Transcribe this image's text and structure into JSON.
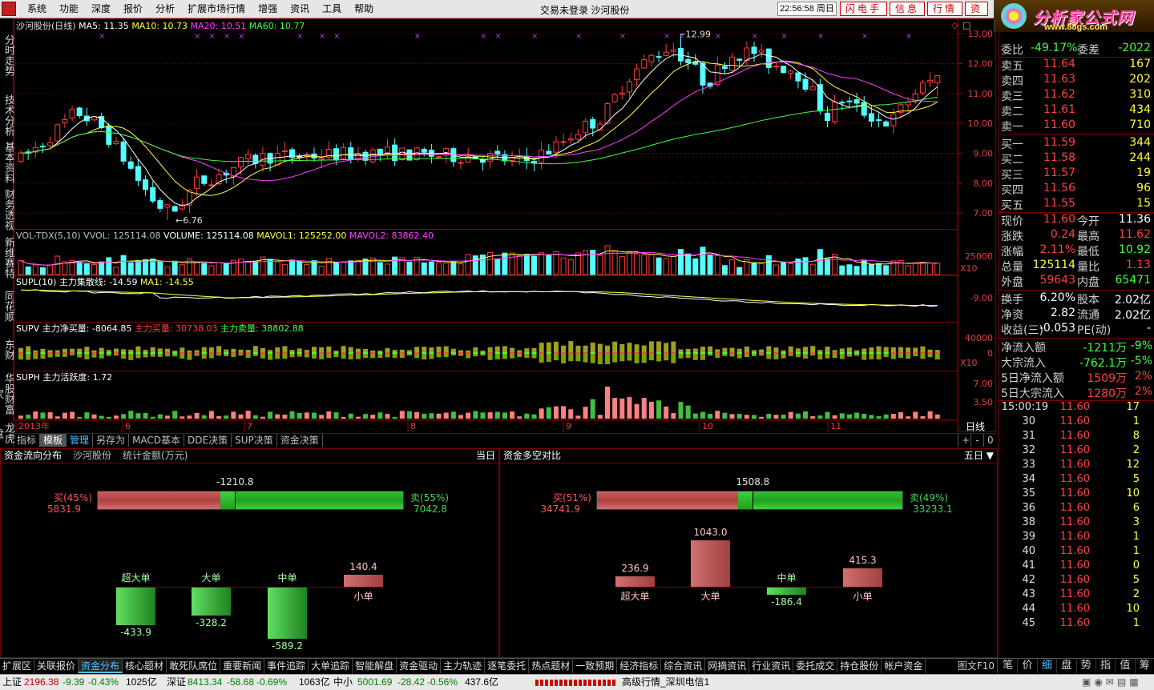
{
  "menubar": {
    "items": [
      "系统",
      "功能",
      "深度",
      "报价",
      "分析",
      "扩展市场行情",
      "增强",
      "资讯",
      "工具",
      "帮助"
    ],
    "center_text": "交易未登录  沙河股份",
    "clock": "22:56:58 周日",
    "buttons": [
      "闪电手",
      "信息",
      "行情",
      "资"
    ],
    "ad_title": "分析家公式网",
    "ad_url": "www.88gs.com"
  },
  "left_tabs": [
    "分时走势",
    "技术分析",
    "基本资料",
    "财务透视",
    "新维赛特",
    "同花顺",
    "东财",
    "华股财富家",
    "龙虎盘"
  ],
  "chart": {
    "title_stock": "沙河股份(日线)",
    "ma_labels": [
      {
        "text": "MA5: 11.35",
        "color": "#ffffff"
      },
      {
        "text": "MA10: 10.73",
        "color": "#ffff40"
      },
      {
        "text": "MA20: 10.51",
        "color": "#ff40ff"
      },
      {
        "text": "MA60: 10.77",
        "color": "#40ff40"
      }
    ],
    "price_axis": [
      "13.00",
      "12.00",
      "11.00",
      "10.00",
      "9.00",
      "8.00",
      "7.00"
    ],
    "high_label": "12.99",
    "low_label": "6.76",
    "vol_title": [
      {
        "text": "VOL-TDX(5,10)  VVOL: 125114.08",
        "color": "#c0c0c0"
      },
      {
        "text": "VOLUME: 125114.08",
        "color": "#ffffff"
      },
      {
        "text": "MAVOL1: 125252.00",
        "color": "#ffff40"
      },
      {
        "text": "MAVOL2: 83862.40",
        "color": "#ff40ff"
      }
    ],
    "vol_axis": "25000",
    "vol_mult": "X10",
    "supl_title": [
      {
        "text": "SUPL(10)  主力集散线: -14.59",
        "color": "#ffffff"
      },
      {
        "text": "MA1: -14.55",
        "color": "#ffff40"
      }
    ],
    "supl_axis": "-9.00",
    "supv_title": [
      {
        "text": "SUPV  主力净买量: -8064.85",
        "color": "#ffffff"
      },
      {
        "text": "主力买量: 30738.03",
        "color": "#ff4040"
      },
      {
        "text": "主力卖量: 38802.88",
        "color": "#40ff40"
      }
    ],
    "supv_axis": [
      "40000",
      "0"
    ],
    "supv_mult": "X10",
    "suph_title": "SUPH  主力活跃度: 1.72",
    "suph_axis": [
      "7.00",
      "3.50"
    ],
    "date_labels": [
      "2013年",
      "6",
      "7",
      "8",
      "9",
      "10",
      "11"
    ],
    "period": "日线"
  },
  "bottom_tabs": [
    "指标",
    "模板",
    "管理",
    "另存为",
    "MACD基本",
    "DDE决策",
    "SUP决策",
    "资金决策"
  ],
  "panel_left": {
    "title": "资金流向分布",
    "stock": "沙河股份",
    "unit": "统计金额(万元)",
    "range": "当日",
    "net": "-1210.8",
    "buy_label": "买(45%)",
    "buy_value": "5831.9",
    "sell_label": "卖(55%)",
    "sell_value": "7042.8",
    "buy_ratio": 0.45,
    "bars": [
      {
        "name": "超大单",
        "value": -433.9,
        "text": "-433.9"
      },
      {
        "name": "大单",
        "value": -328.2,
        "text": "-328.2"
      },
      {
        "name": "中单",
        "value": -589.2,
        "text": "-589.2"
      },
      {
        "name": "小单",
        "value": 140.4,
        "text": "140.4"
      }
    ]
  },
  "panel_right": {
    "title": "资金多空对比",
    "range": "五日",
    "net": "1508.8",
    "buy_label": "买(51%)",
    "buy_value": "34741.9",
    "sell_label": "卖(49%)",
    "sell_value": "33233.1",
    "buy_ratio": 0.51,
    "bars": [
      {
        "name": "超大单",
        "value": 236.9,
        "text": "236.9"
      },
      {
        "name": "大单",
        "value": 1043.0,
        "text": "1043.0"
      },
      {
        "name": "中单",
        "value": -186.4,
        "text": "-186.4"
      },
      {
        "name": "小单",
        "value": 415.3,
        "text": "415.3"
      }
    ]
  },
  "funcbar": [
    "扩展区",
    "关联报价",
    "资金分布",
    "核心题材",
    "敢死队席位",
    "重要新闻",
    "事件追踪",
    "大单追踪",
    "智能解盘",
    "资金驱动",
    "主力轨迹",
    "逐笔委托",
    "热点题材",
    "一致预期",
    "经济指标",
    "综合资讯",
    "网摘资讯",
    "行业资讯",
    "委托成交",
    "持仓股份",
    "帐户资金"
  ],
  "funcbar_active": "资金分布",
  "funcbar_pic": "图文F10",
  "quote": {
    "ratio": {
      "label1": "委比",
      "value1": "-49.17%",
      "label2": "委差",
      "value2": "-2022"
    },
    "sells": [
      {
        "name": "卖五",
        "price": "11.64",
        "vol": "167"
      },
      {
        "name": "卖四",
        "price": "11.63",
        "vol": "202"
      },
      {
        "name": "卖三",
        "price": "11.62",
        "vol": "310"
      },
      {
        "name": "卖二",
        "price": "11.61",
        "vol": "434"
      },
      {
        "name": "卖一",
        "price": "11.60",
        "vol": "710"
      }
    ],
    "buys": [
      {
        "name": "买一",
        "price": "11.59",
        "vol": "344"
      },
      {
        "name": "买二",
        "price": "11.58",
        "vol": "244"
      },
      {
        "name": "买三",
        "price": "11.57",
        "vol": "19"
      },
      {
        "name": "买四",
        "price": "11.56",
        "vol": "96"
      },
      {
        "name": "买五",
        "price": "11.55",
        "vol": "15"
      }
    ],
    "stats": [
      {
        "k1": "现价",
        "v1": "11.60",
        "c1": "#ff4040",
        "k2": "今开",
        "v2": "11.36",
        "c2": "#ffffff"
      },
      {
        "k1": "涨跌",
        "v1": "0.24",
        "c1": "#ff4040",
        "k2": "最高",
        "v2": "11.62",
        "c2": "#ff4040"
      },
      {
        "k1": "涨幅",
        "v1": "2.11%",
        "c1": "#ff4040",
        "k2": "最低",
        "v2": "10.92",
        "c2": "#40ff40"
      },
      {
        "k1": "总量",
        "v1": "125114",
        "c1": "#ffff40",
        "k2": "量比",
        "v2": "1.13",
        "c2": "#ff4040"
      },
      {
        "k1": "外盘",
        "v1": "59643",
        "c1": "#ff4040",
        "k2": "内盘",
        "v2": "65471",
        "c2": "#40ff40"
      }
    ],
    "stats2": [
      {
        "k1": "换手",
        "v1": "6.20%",
        "c1": "#ffffff",
        "k2": "股本",
        "v2": "2.02亿",
        "c2": "#ffffff"
      },
      {
        "k1": "净资",
        "v1": "2.82",
        "c1": "#ffffff",
        "k2": "流通",
        "v2": "2.02亿",
        "c2": "#ffffff"
      },
      {
        "k1": "收益(三)",
        "v1": "-0.053",
        "c1": "#ffffff",
        "k2": "PE(动)",
        "v2": "-",
        "c2": "#ffffff"
      }
    ],
    "flows": [
      {
        "k": "净流入额",
        "v": "-1211万",
        "c": "#40ff40",
        "p": "-9%",
        "pc": "#40ff40"
      },
      {
        "k": "大宗流入",
        "v": "-762.1万",
        "c": "#40ff40",
        "p": "-5%",
        "pc": "#40ff40"
      },
      {
        "k": "5日净流入额",
        "v": "1509万",
        "c": "#ff4040",
        "p": "2%",
        "pc": "#ff4040"
      },
      {
        "k": "5日大宗流入",
        "v": "1280万",
        "c": "#ff4040",
        "p": "2%",
        "pc": "#ff4040"
      }
    ],
    "ticks": [
      {
        "t": "15:00:19",
        "p": "11.60",
        "v": "17"
      },
      {
        "t": "30",
        "p": "11.60",
        "v": "1"
      },
      {
        "t": "31",
        "p": "11.60",
        "v": "8"
      },
      {
        "t": "32",
        "p": "11.60",
        "v": "2"
      },
      {
        "t": "33",
        "p": "11.60",
        "v": "12"
      },
      {
        "t": "34",
        "p": "11.60",
        "v": "5"
      },
      {
        "t": "35",
        "p": "11.60",
        "v": "10"
      },
      {
        "t": "36",
        "p": "11.60",
        "v": "6"
      },
      {
        "t": "38",
        "p": "11.60",
        "v": "3"
      },
      {
        "t": "39",
        "p": "11.60",
        "v": "1"
      },
      {
        "t": "40",
        "p": "11.60",
        "v": "1"
      },
      {
        "t": "41",
        "p": "11.60",
        "v": "0"
      },
      {
        "t": "42",
        "p": "11.60",
        "v": "5"
      },
      {
        "t": "43",
        "p": "11.60",
        "v": "2"
      },
      {
        "t": "44",
        "p": "11.60",
        "v": "10"
      },
      {
        "t": "45",
        "p": "11.60",
        "v": "1"
      }
    ],
    "tabs": [
      "笔",
      "价",
      "细",
      "盘",
      "势",
      "指",
      "值",
      "筹"
    ],
    "active_tab": "细"
  },
  "statusbar": {
    "items": [
      {
        "text": "上证",
        "c": "#000"
      },
      {
        "text": "2196.38",
        "c": "#c00000"
      },
      {
        "text": "-9.39",
        "c": "#008000"
      },
      {
        "text": "-0.43%",
        "c": "#008000"
      },
      {
        "text": "1025亿",
        "c": "#000"
      },
      {
        "text": "深证",
        "c": "#000"
      },
      {
        "text": "8413.34",
        "c": "#008000"
      },
      {
        "text": "-58.68",
        "c": "#008000"
      },
      {
        "text": "-0.69%",
        "c": "#008000"
      },
      {
        "text": "1063亿",
        "c": "#000"
      },
      {
        "text": "中小",
        "c": "#000"
      },
      {
        "text": "5001.69",
        "c": "#008000"
      },
      {
        "text": "-28.42",
        "c": "#008000"
      },
      {
        "text": "-0.56%",
        "c": "#008000"
      },
      {
        "text": "437.6亿",
        "c": "#000"
      }
    ],
    "server": "高级行情_深圳电信1"
  }
}
